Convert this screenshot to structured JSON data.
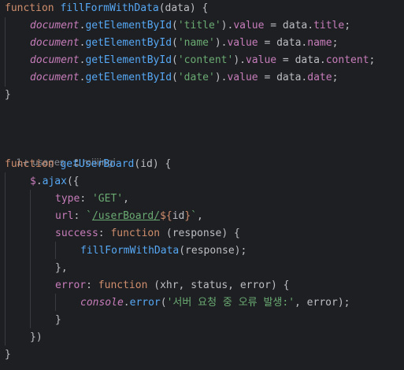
{
  "code": {
    "lines": [
      [
        [
          "kw",
          "function "
        ],
        [
          "fn",
          "fillFormWithData"
        ],
        [
          "plain",
          "(data) {"
        ]
      ],
      [
        [
          "glob",
          "document"
        ],
        [
          "plain",
          "."
        ],
        [
          "call",
          "getElementById"
        ],
        [
          "plain",
          "("
        ],
        [
          "str",
          "'title'"
        ],
        [
          "plain",
          ")."
        ],
        [
          "prop",
          "value"
        ],
        [
          "plain",
          " = data."
        ],
        [
          "prop",
          "title"
        ],
        [
          "plain",
          ";"
        ]
      ],
      [
        [
          "glob",
          "document"
        ],
        [
          "plain",
          "."
        ],
        [
          "call",
          "getElementById"
        ],
        [
          "plain",
          "("
        ],
        [
          "str",
          "'name'"
        ],
        [
          "plain",
          ")."
        ],
        [
          "prop",
          "value"
        ],
        [
          "plain",
          " = data."
        ],
        [
          "prop",
          "name"
        ],
        [
          "plain",
          ";"
        ]
      ],
      [
        [
          "glob",
          "document"
        ],
        [
          "plain",
          "."
        ],
        [
          "call",
          "getElementById"
        ],
        [
          "plain",
          "("
        ],
        [
          "str",
          "'content'"
        ],
        [
          "plain",
          ")."
        ],
        [
          "prop",
          "value"
        ],
        [
          "plain",
          " = data."
        ],
        [
          "prop",
          "content"
        ],
        [
          "plain",
          ";"
        ]
      ],
      [
        [
          "glob",
          "document"
        ],
        [
          "plain",
          "."
        ],
        [
          "call",
          "getElementById"
        ],
        [
          "plain",
          "("
        ],
        [
          "str",
          "'date'"
        ],
        [
          "plain",
          ")."
        ],
        [
          "prop",
          "value"
        ],
        [
          "plain",
          " = data."
        ],
        [
          "prop",
          "date"
        ],
        [
          "plain",
          ";"
        ]
      ],
      [
        [
          "plain",
          "}"
        ]
      ],
      [],
      [],
      [],
      [
        [
          "kw",
          "function "
        ],
        [
          "fn",
          "getUserBoard"
        ],
        [
          "plain",
          "(id) {"
        ]
      ],
      [
        [
          "prop",
          "$"
        ],
        [
          "plain",
          "."
        ],
        [
          "call",
          "ajax"
        ],
        [
          "plain",
          "({"
        ]
      ],
      [
        [
          "prop",
          "type"
        ],
        [
          "plain",
          ": "
        ],
        [
          "str",
          "'GET'"
        ],
        [
          "plain",
          ","
        ]
      ],
      [
        [
          "prop",
          "url"
        ],
        [
          "plain",
          ": "
        ],
        [
          "str",
          "`"
        ],
        [
          "url",
          "/userBoard/"
        ],
        [
          "tmpl",
          "${"
        ],
        [
          "plain",
          "id"
        ],
        [
          "tmpl",
          "}"
        ],
        [
          "str",
          "`"
        ],
        [
          "plain",
          ","
        ]
      ],
      [
        [
          "prop",
          "success"
        ],
        [
          "plain",
          ": "
        ],
        [
          "kw",
          "function "
        ],
        [
          "plain",
          "(response) {"
        ]
      ],
      [
        [
          "call",
          "fillFormWithData"
        ],
        [
          "plain",
          "(response);"
        ]
      ],
      [
        [
          "plain",
          "},"
        ]
      ],
      [
        [
          "prop",
          "error"
        ],
        [
          "plain",
          ": "
        ],
        [
          "kw",
          "function "
        ],
        [
          "plain",
          "(xhr, status, error) {"
        ]
      ],
      [
        [
          "glob",
          "console"
        ],
        [
          "plain",
          "."
        ],
        [
          "call",
          "error"
        ],
        [
          "plain",
          "("
        ],
        [
          "str",
          "'서버 요청 중 오류 발생:'"
        ],
        [
          "plain",
          ", error);"
        ]
      ],
      [
        [
          "plain",
          "}"
        ]
      ],
      [
        [
          "plain",
          "})"
        ]
      ],
      [
        [
          "plain",
          "}"
        ]
      ]
    ],
    "usage_hint": {
      "usages": "1+ usages",
      "author": "miiiingi"
    }
  },
  "colors": {
    "background": "#1e1f22",
    "keyword": "#cf8e6d",
    "function": "#56a8f5",
    "string": "#6aab73",
    "property": "#c77dbb",
    "text": "#bcbec4",
    "hint": "#868a91"
  }
}
